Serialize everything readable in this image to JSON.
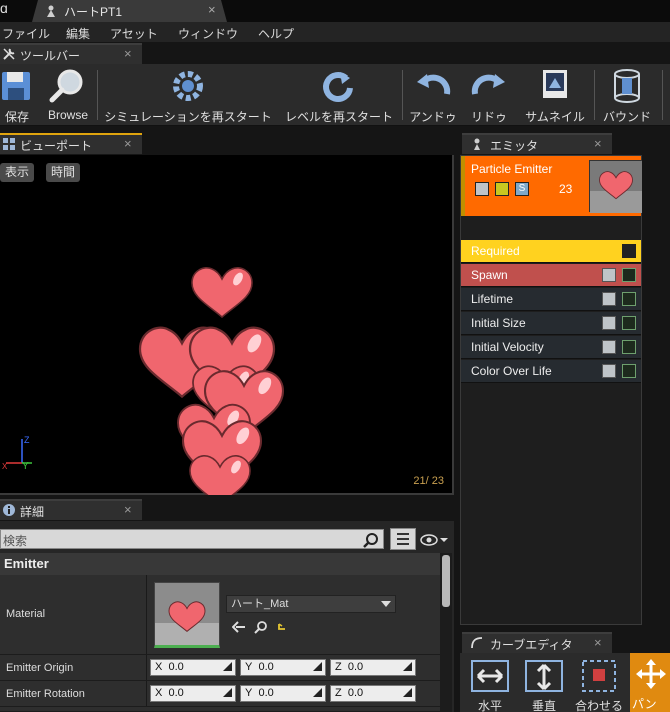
{
  "title_tab": {
    "label": "ハートPT1",
    "close": "×"
  },
  "menu": [
    "ファイル",
    "編集",
    "アセット",
    "ウィンドウ",
    "ヘルプ"
  ],
  "toolbar_tab": {
    "label": "ツールバー",
    "close": "×"
  },
  "toolbar": {
    "save": "保存",
    "browse": "Browse",
    "restart_sim": "シミュレーションを再スタート",
    "restart_level": "レベルを再スタート",
    "undo": "アンドゥ",
    "redo": "リドゥ",
    "thumbnail": "サムネイル",
    "bounds": "バウンド"
  },
  "viewport_tab": {
    "label": "ビューポート",
    "close": "×"
  },
  "viewport": {
    "show": "表示",
    "time": "時間",
    "counter": "21/ 23",
    "axis_z": "Z",
    "axis_y": "Y",
    "axis_x": "X"
  },
  "emitter_tab": {
    "label": "エミッタ",
    "close": "×"
  },
  "emitter": {
    "name": "Particle Emitter",
    "count": "23",
    "solo_label": "S",
    "modules": [
      {
        "label": "Required",
        "color": "#ffd700"
      },
      {
        "label": "Spawn",
        "color": "#c0504d"
      },
      {
        "label": "Lifetime",
        "color": "#262b30"
      },
      {
        "label": "Initial Size",
        "color": "#262b30"
      },
      {
        "label": "Initial Velocity",
        "color": "#262b30"
      },
      {
        "label": "Color Over Life",
        "color": "#262b30"
      }
    ]
  },
  "details_tab": {
    "label": "詳細",
    "close": "×"
  },
  "details": {
    "search_placeholder": "検索",
    "section": "Emitter",
    "material_label": "Material",
    "material_value": "ハート_Mat",
    "origin_label": "Emitter Origin",
    "rotation_label": "Emitter Rotation",
    "origin": {
      "x_label": "X",
      "x": "0.0",
      "y_label": "Y",
      "y": "0.0",
      "z_label": "Z",
      "z": "0.0"
    },
    "rotation": {
      "x_label": "X",
      "x": "0.0",
      "y_label": "Y",
      "y": "0.0",
      "z_label": "Z",
      "z": "0.0"
    }
  },
  "curve_tab": {
    "label": "カーブエディタ",
    "close": "×"
  },
  "curve": {
    "horizontal": "水平",
    "vertical": "垂直",
    "fit": "合わせる",
    "pan": "パン"
  },
  "colors": {
    "accent": "#e0a40e",
    "emitter_header": "#ff6a00",
    "heart": "#f0666e"
  }
}
